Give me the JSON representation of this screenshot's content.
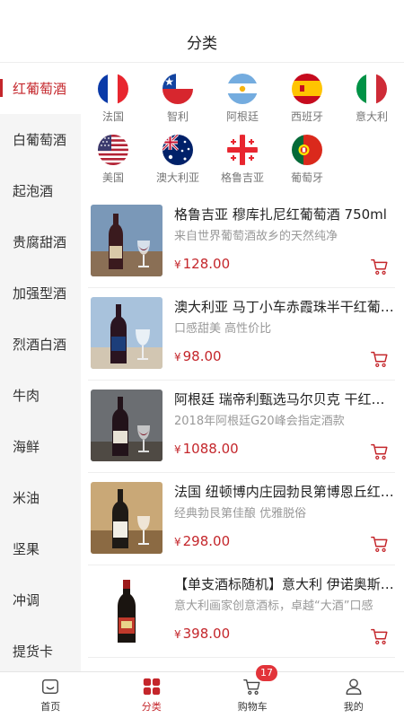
{
  "header": {
    "title": "分类"
  },
  "sidebar": {
    "items": [
      {
        "label": "红葡萄酒",
        "active": true
      },
      {
        "label": "白葡萄酒"
      },
      {
        "label": "起泡酒"
      },
      {
        "label": "贵腐甜酒"
      },
      {
        "label": "加强型酒"
      },
      {
        "label": "烈酒白酒"
      },
      {
        "label": "牛肉"
      },
      {
        "label": "海鲜"
      },
      {
        "label": "米油"
      },
      {
        "label": "坚果"
      },
      {
        "label": "冲调"
      },
      {
        "label": "提货卡"
      }
    ]
  },
  "countries": [
    {
      "name": "法国",
      "flag": "france-flag-icon"
    },
    {
      "name": "智利",
      "flag": "chile-flag-icon"
    },
    {
      "name": "阿根廷",
      "flag": "argentina-flag-icon"
    },
    {
      "name": "西班牙",
      "flag": "spain-flag-icon"
    },
    {
      "name": "意大利",
      "flag": "italy-flag-icon"
    },
    {
      "name": "美国",
      "flag": "usa-flag-icon"
    },
    {
      "name": "澳大利亚",
      "flag": "australia-flag-icon"
    },
    {
      "name": "格鲁吉亚",
      "flag": "georgia-flag-icon"
    },
    {
      "name": "葡萄牙",
      "flag": "portugal-flag-icon"
    }
  ],
  "products": [
    {
      "name": "格鲁吉亚 穆库扎尼红葡萄酒 750ml",
      "desc": "来自世界葡萄酒故乡的天然纯净",
      "currency": "¥",
      "price": "128.00"
    },
    {
      "name": "澳大利亚 马丁小车赤霞珠半干红葡萄酒",
      "desc": "口感甜美 高性价比",
      "currency": "¥",
      "price": "98.00"
    },
    {
      "name": "阿根廷 瑞帝利甄选马尔贝克 干红葡萄酒",
      "desc": "2018年阿根廷G20峰会指定酒款",
      "currency": "¥",
      "price": "1088.00"
    },
    {
      "name": "法国 纽顿博内庄园勃艮第博恩丘红葡萄酒",
      "desc": "经典勃艮第佳酿 优雅脱俗",
      "currency": "¥",
      "price": "298.00"
    },
    {
      "name": "【单支酒标随机】意大利 伊诺奥斯红葡萄酒",
      "desc": "意大利画家创意酒标，卓越“大酒”口感",
      "currency": "¥",
      "price": "398.00"
    }
  ],
  "tabbar": {
    "home": "首页",
    "category": "分类",
    "cart": "购物车",
    "cart_count": "17",
    "mine": "我的"
  },
  "colors": {
    "accent": "#c4262b",
    "badge": "#e2343a"
  }
}
